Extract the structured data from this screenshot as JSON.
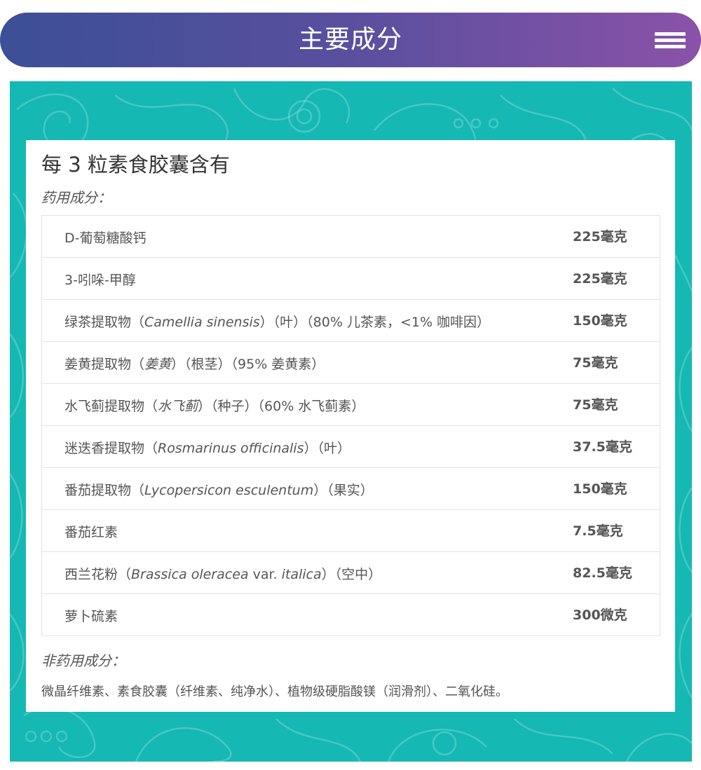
{
  "header": {
    "title": "主要成分",
    "menu_icon": "hamburger-menu-icon",
    "gradient_start": "#3b4f97",
    "gradient_end": "#8a52a8"
  },
  "panel": {
    "background_color": "#15b8b3",
    "pattern_icon": "paisley-pattern"
  },
  "card": {
    "title": "每 3 粒素食胶囊含有",
    "active_heading": "药用成分：",
    "ingredients": [
      {
        "segments": [
          {
            "t": "D-葡萄糖酸钙"
          }
        ],
        "amount": "225毫克"
      },
      {
        "segments": [
          {
            "t": "3-吲哚-甲醇"
          }
        ],
        "amount": "225毫克"
      },
      {
        "segments": [
          {
            "t": "绿茶提取物（"
          },
          {
            "t": "Camellia sinensis",
            "i": true
          },
          {
            "t": "）（叶）（80% 儿茶素，<1% 咖啡因）"
          }
        ],
        "amount": "150毫克"
      },
      {
        "segments": [
          {
            "t": "姜黄提取物（"
          },
          {
            "t": "姜黄",
            "i": true
          },
          {
            "t": "）（根茎）（95% 姜黄素）"
          }
        ],
        "amount": "75毫克"
      },
      {
        "segments": [
          {
            "t": "水飞蓟提取物（"
          },
          {
            "t": "水飞蓟",
            "i": true
          },
          {
            "t": "）（种子）（60% 水飞蓟素）"
          }
        ],
        "amount": "75毫克"
      },
      {
        "segments": [
          {
            "t": "迷迭香提取物（"
          },
          {
            "t": "Rosmarinus officinalis",
            "i": true
          },
          {
            "t": "）（叶）"
          }
        ],
        "amount": "37.5毫克"
      },
      {
        "segments": [
          {
            "t": "番茄提取物（"
          },
          {
            "t": "Lycopersicon esculentum",
            "i": true
          },
          {
            "t": "）（果实）"
          }
        ],
        "amount": "150毫克"
      },
      {
        "segments": [
          {
            "t": "番茄红素"
          }
        ],
        "amount": "7.5毫克"
      },
      {
        "segments": [
          {
            "t": "西兰花粉（"
          },
          {
            "t": "Brassica oleracea",
            "i": true
          },
          {
            "t": " var. "
          },
          {
            "t": "italica",
            "i": true
          },
          {
            "t": "）（空中）"
          }
        ],
        "amount": "82.5毫克"
      },
      {
        "segments": [
          {
            "t": "萝卜硫素"
          }
        ],
        "amount": "300微克"
      }
    ],
    "inactive_heading": "非药用成分：",
    "inactive_text": "微晶纤维素、素食胶囊（纤维素、纯净水）、植物级硬脂酸镁（润滑剂）、二氧化硅。"
  }
}
